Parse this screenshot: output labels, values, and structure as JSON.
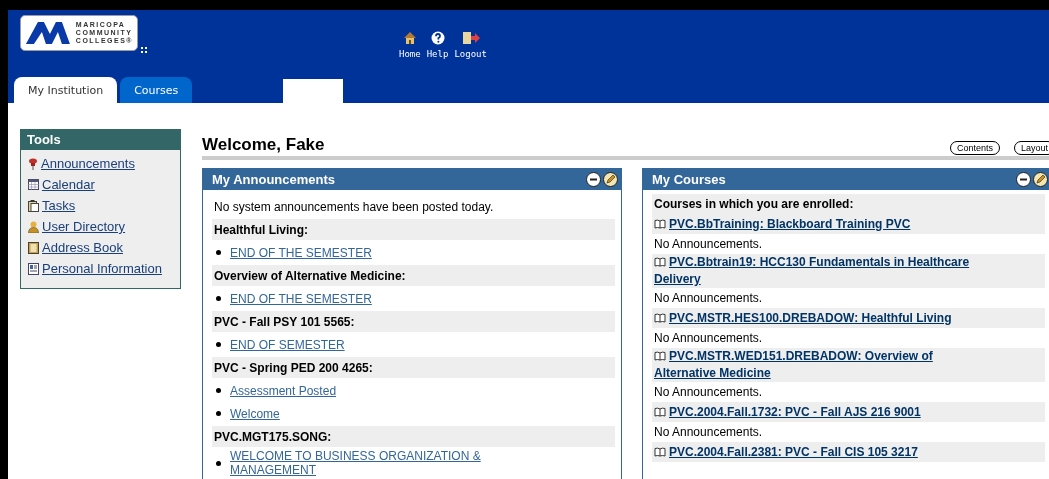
{
  "header": {
    "logo": [
      "MARICOPA",
      "COMMUNITY",
      "COLLEGES®"
    ],
    "nav": [
      {
        "label": "Home"
      },
      {
        "label": "Help"
      },
      {
        "label": "Logout"
      }
    ]
  },
  "tabs": [
    {
      "label": "My Institution",
      "selected": true
    },
    {
      "label": "Courses",
      "selected": false
    }
  ],
  "tools": {
    "title": "Tools",
    "items": [
      {
        "label": "Announcements"
      },
      {
        "label": "Calendar"
      },
      {
        "label": "Tasks"
      },
      {
        "label": "User Directory"
      },
      {
        "label": "Address Book"
      },
      {
        "label": "Personal Information"
      }
    ]
  },
  "welcome": "Welcome, Fake",
  "buttons": [
    "Contents",
    "Layout"
  ],
  "announcements": {
    "title": "My Announcements",
    "items": [
      {
        "kind": "note",
        "text": "No system announcements have been posted today."
      },
      {
        "kind": "heading",
        "text": "Healthful Living:"
      },
      {
        "kind": "link",
        "text": "END OF THE SEMESTER"
      },
      {
        "kind": "heading",
        "text": "Overview of Alternative Medicine:"
      },
      {
        "kind": "link",
        "text": "END OF THE SEMESTER"
      },
      {
        "kind": "heading",
        "text": "PVC - Fall PSY 101 5565:"
      },
      {
        "kind": "link",
        "text": "END OF SEMESTER"
      },
      {
        "kind": "heading",
        "text": "PVC - Spring PED 200 4265:"
      },
      {
        "kind": "link",
        "text": "Assessment Posted"
      },
      {
        "kind": "link",
        "text": "Welcome"
      },
      {
        "kind": "heading",
        "text": "PVC.MGT175.SONG:"
      },
      {
        "kind": "link",
        "text": "WELCOME TO BUSINESS ORGANIZATION & MANAGEMENT"
      }
    ]
  },
  "courses": {
    "title": "My Courses",
    "items": [
      {
        "kind": "heading",
        "text": "Courses in which you are enrolled:"
      },
      {
        "kind": "course",
        "text": "PVC.BbTraining: Blackboard Training PVC"
      },
      {
        "kind": "note",
        "text": "No Announcements."
      },
      {
        "kind": "course",
        "text": "PVC.Bbtrain19: HCC130 Fundamentals in Healthcare Delivery"
      },
      {
        "kind": "note",
        "text": "No Announcements."
      },
      {
        "kind": "course",
        "text": "PVC.MSTR.HES100.DREBADOW: Healthful Living"
      },
      {
        "kind": "note",
        "text": "No Announcements."
      },
      {
        "kind": "course",
        "text": "PVC.MSTR.WED151.DREBADOW: Overview of Alternative Medicine"
      },
      {
        "kind": "note",
        "text": "No Announcements."
      },
      {
        "kind": "course",
        "text": "PVC.2004.Fall.1732: PVC - Fall AJS 216 9001"
      },
      {
        "kind": "note",
        "text": "No Announcements."
      },
      {
        "kind": "course",
        "text": "PVC.2004.Fall.2381: PVC - Fall CIS 105 3217"
      }
    ]
  }
}
